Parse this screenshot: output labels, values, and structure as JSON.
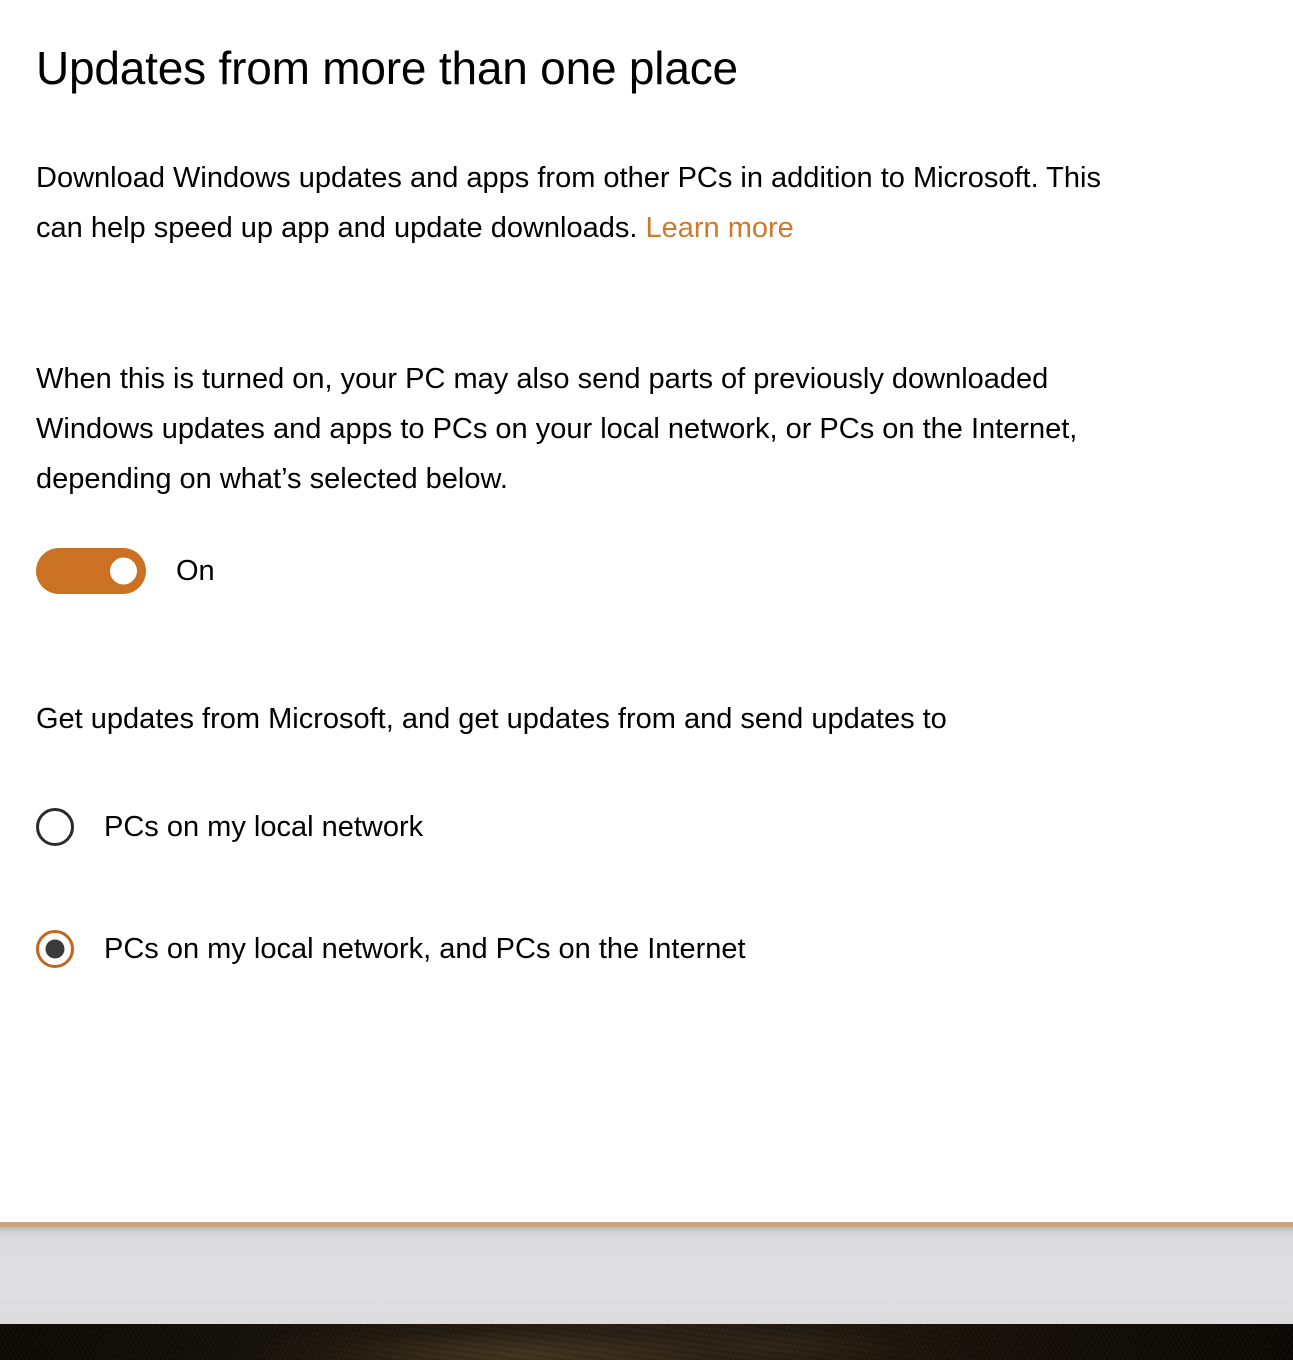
{
  "page": {
    "title": "Updates from more than one place",
    "description_lead": "Download Windows updates and apps from other PCs in addition to Microsoft. This can help speed up app and update downloads. ",
    "learn_more_label": "Learn more",
    "description_detail": "When this is turned on, your PC may also send parts of previously downloaded Windows updates and apps to PCs on your local network, or PCs on the Internet, depending on what’s selected below.",
    "options_prompt": "Get updates from Microsoft, and get updates from and send updates to"
  },
  "toggle": {
    "name": "delivery-optimization-toggle",
    "state_label": "On",
    "checked": true,
    "on_color": "#CB7123",
    "knob_color": "#FFFFFF"
  },
  "radio_group": {
    "selected_index": 1,
    "options": [
      {
        "label": "PCs on my local network",
        "checked": false
      },
      {
        "label": "PCs on my local network, and PCs on the Internet",
        "checked": true
      }
    ],
    "checked_ring_color": "#C4651F",
    "checked_dot_color": "#3A3A3A",
    "unchecked_ring_color": "#2B2B2B"
  },
  "colors": {
    "accent_link": "#CE7A2E",
    "accent_line": "#CBA581",
    "taskbar": "#DEDEE0",
    "desktop": "#1A140C",
    "page_background": "#FFFFFF",
    "text": "#000000"
  }
}
